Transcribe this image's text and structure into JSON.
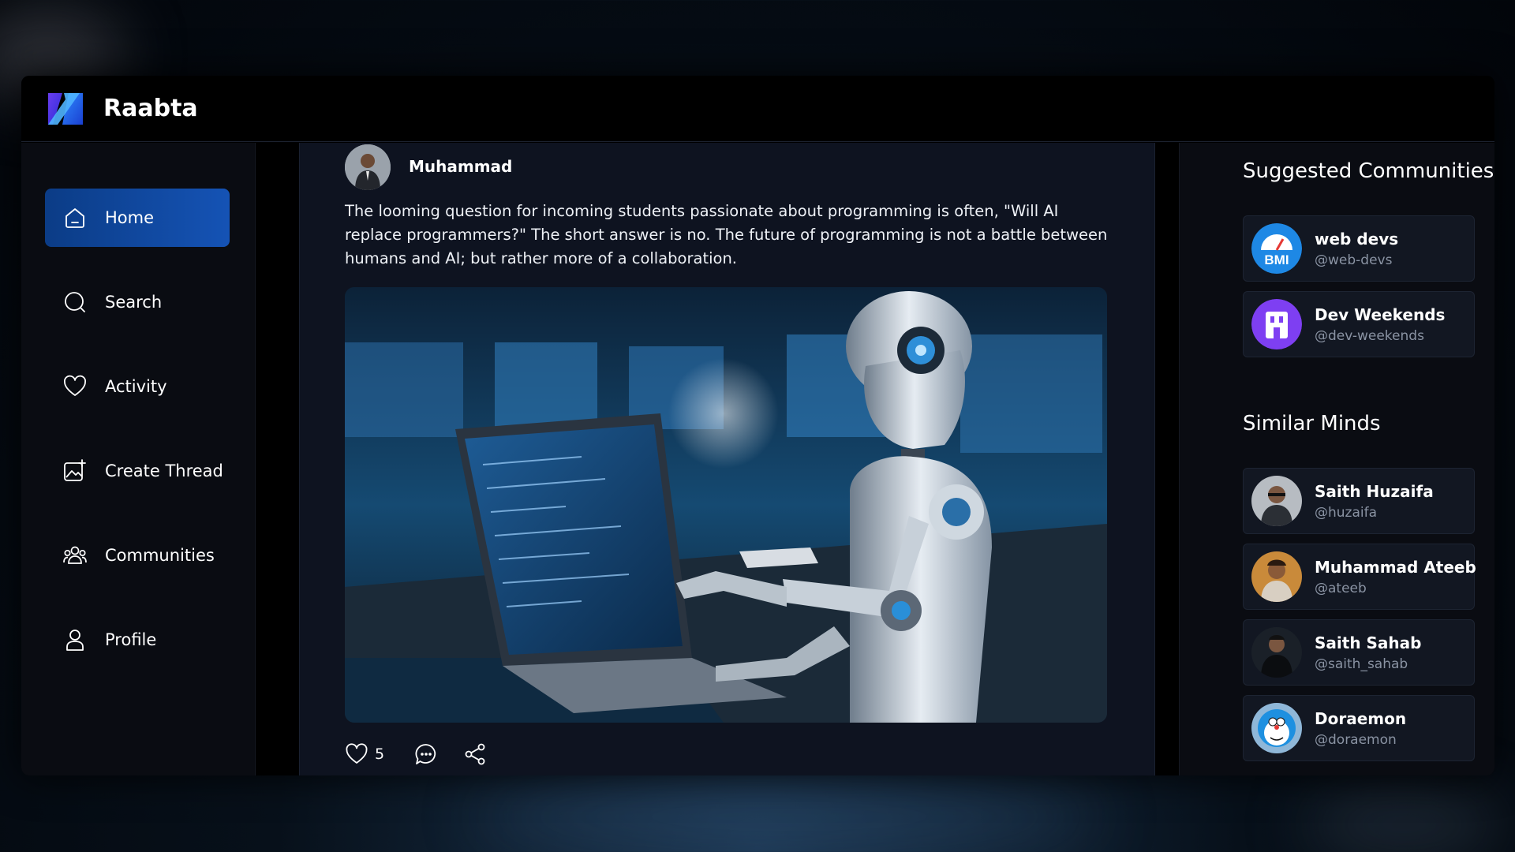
{
  "app": {
    "name": "Raabta",
    "accent": "#1553b5"
  },
  "nav": {
    "items": [
      {
        "label": "Home",
        "icon": "home-icon",
        "active": true
      },
      {
        "label": "Search",
        "icon": "search-icon",
        "active": false
      },
      {
        "label": "Activity",
        "icon": "heart-icon",
        "active": false
      },
      {
        "label": "Create Thread",
        "icon": "create-thread-icon",
        "active": false
      },
      {
        "label": "Communities",
        "icon": "communities-icon",
        "active": false
      },
      {
        "label": "Profile",
        "icon": "profile-icon",
        "active": false
      }
    ]
  },
  "post": {
    "author": "Muhammad",
    "text": "The looming question for incoming students passionate about programming is often, \"Will AI replace programmers?\" The short answer is no. The future of programming is not a battle between humans and AI; but rather more of a collaboration.",
    "likes": "5",
    "image": "robot-coding-at-laptop-image"
  },
  "suggested_communities": {
    "title": "Suggested Communities",
    "items": [
      {
        "name": "web devs",
        "handle": "@web-devs",
        "avatar_text": "BMI"
      },
      {
        "name": "Dev Weekends",
        "handle": "@dev-weekends"
      }
    ]
  },
  "similar_minds": {
    "title": "Similar Minds",
    "items": [
      {
        "name": "Saith Huzaifa",
        "handle": "@huzaifa"
      },
      {
        "name": "Muhammad Ateeb",
        "handle": "@ateeb"
      },
      {
        "name": "Saith Sahab",
        "handle": "@saith_sahab"
      },
      {
        "name": "Doraemon",
        "handle": "@doraemon"
      }
    ]
  }
}
